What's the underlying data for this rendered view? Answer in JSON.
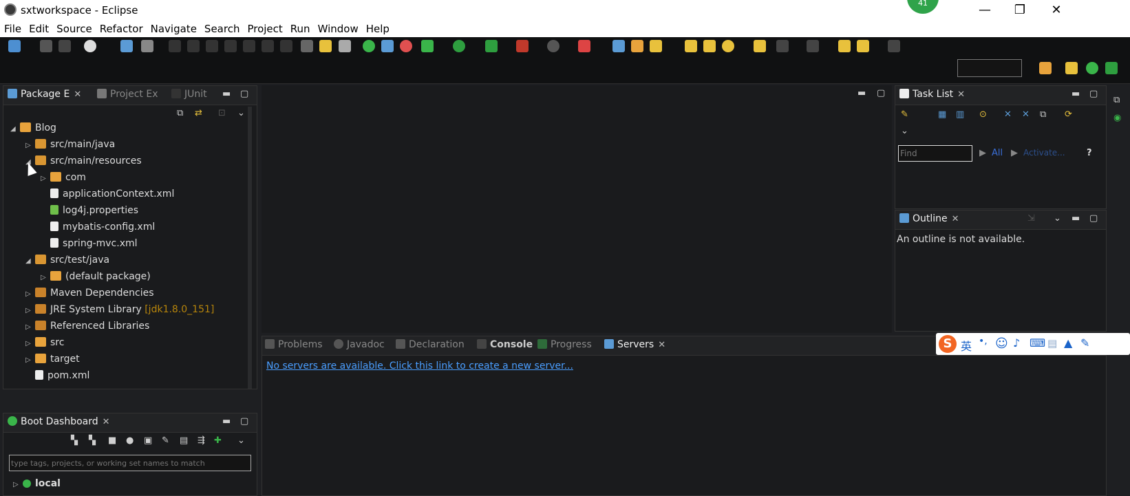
{
  "window": {
    "title": "sxtworkspace - Eclipse",
    "minimize": "—",
    "maximize": "❐",
    "close": "✕",
    "notification_count": "41"
  },
  "menu": [
    "File",
    "Edit",
    "Source",
    "Refactor",
    "Navigate",
    "Search",
    "Project",
    "Run",
    "Window",
    "Help"
  ],
  "left_panel": {
    "tabs": [
      "Package E",
      "Project Ex",
      "JUnit"
    ],
    "tree": [
      {
        "label": "Blog",
        "level": 0,
        "twisty": "◢"
      },
      {
        "label": "src/main/java",
        "level": 1,
        "twisty": "▷"
      },
      {
        "label": "src/main/resources",
        "level": 1,
        "twisty": "◢"
      },
      {
        "label": "com",
        "level": 2,
        "twisty": "▷"
      },
      {
        "label": "applicationContext.xml",
        "level": 2,
        "twisty": ""
      },
      {
        "label": "log4j.properties",
        "level": 2,
        "twisty": ""
      },
      {
        "label": "mybatis-config.xml",
        "level": 2,
        "twisty": ""
      },
      {
        "label": "spring-mvc.xml",
        "level": 2,
        "twisty": ""
      },
      {
        "label": "src/test/java",
        "level": 1,
        "twisty": "◢"
      },
      {
        "label": "(default package)",
        "level": 2,
        "twisty": "▷"
      },
      {
        "label": "Maven Dependencies",
        "level": 1,
        "twisty": "▷"
      },
      {
        "label": "JRE System Library",
        "level": 1,
        "twisty": "▷",
        "suffix": "[jdk1.8.0_151]"
      },
      {
        "label": "Referenced Libraries",
        "level": 1,
        "twisty": "▷"
      },
      {
        "label": "src",
        "level": 1,
        "twisty": "▷"
      },
      {
        "label": "target",
        "level": 1,
        "twisty": "▷"
      },
      {
        "label": "pom.xml",
        "level": 1,
        "twisty": ""
      }
    ]
  },
  "boot_dashboard": {
    "tab": "Boot Dashboard",
    "filter_placeholder": "type tags, projects, or working set names to match",
    "local": "local"
  },
  "task_list": {
    "tab": "Task List",
    "find_placeholder": "Find",
    "all": "All",
    "activate": "Activate..."
  },
  "outline": {
    "tab": "Outline",
    "message": "An outline is not available."
  },
  "bottom_panel": {
    "tabs": [
      "Problems",
      "Javadoc",
      "Declaration",
      "Console",
      "Progress",
      "Servers"
    ],
    "servers_link": "No servers are available. Click this link to create a new server..."
  },
  "ime": {
    "lang": "英",
    "punct": "•,"
  },
  "colors": {
    "accent_link": "#4a9eff",
    "folder": "#e8a33c",
    "background": "#1e1f22"
  }
}
